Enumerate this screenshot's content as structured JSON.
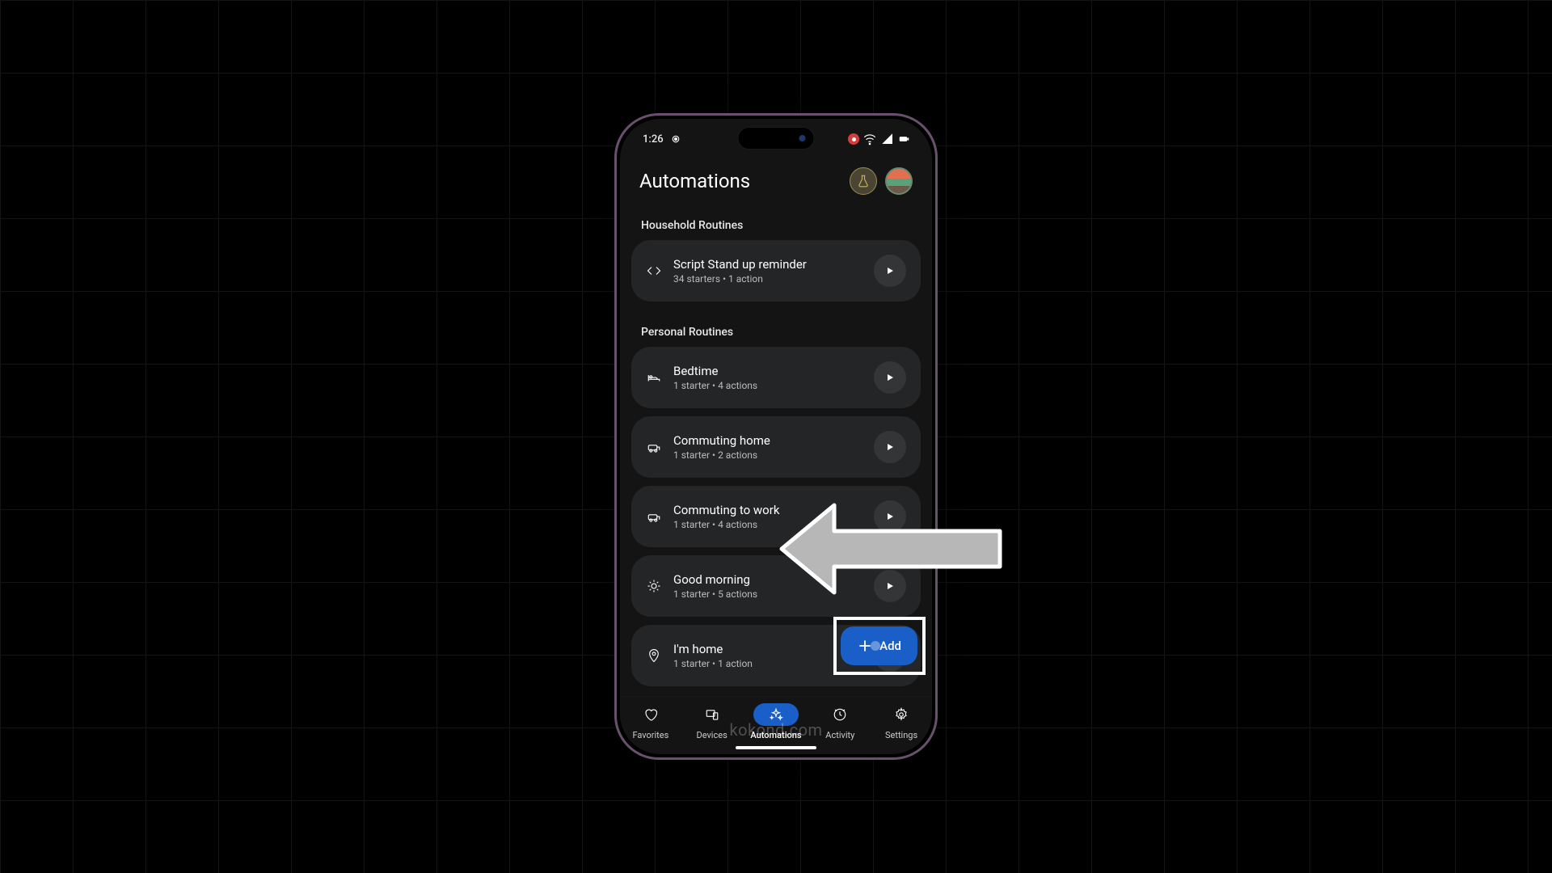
{
  "status": {
    "time": "1:26",
    "rec_icon": "record-icon",
    "wifi": "wifi-icon",
    "signal": "signal-icon",
    "battery": "battery-icon"
  },
  "header": {
    "title": "Automations",
    "lab_icon": "lab-flask-icon",
    "avatar_alt": "profile-avatar"
  },
  "sections": {
    "household": {
      "label": "Household Routines",
      "items": [
        {
          "icon": "code-icon",
          "title": "Script Stand up reminder",
          "subtitle": "34 starters • 1 action"
        }
      ]
    },
    "personal": {
      "label": "Personal Routines",
      "items": [
        {
          "icon": "bed-icon",
          "title": "Bedtime",
          "subtitle": "1 starter • 4 actions"
        },
        {
          "icon": "commute-home-icon",
          "title": "Commuting home",
          "subtitle": "1 starter • 2 actions"
        },
        {
          "icon": "commute-work-icon",
          "title": "Commuting to work",
          "subtitle": "1 starter • 4 actions"
        },
        {
          "icon": "sun-icon",
          "title": "Good morning",
          "subtitle": "1 starter • 5 actions"
        },
        {
          "icon": "location-icon",
          "title": "I'm home",
          "subtitle": "1 starter • 1 action"
        }
      ]
    }
  },
  "fab": {
    "label": "Add"
  },
  "nav": [
    {
      "icon": "heart-icon",
      "label": "Favorites",
      "active": false
    },
    {
      "icon": "devices-icon",
      "label": "Devices",
      "active": false
    },
    {
      "icon": "sparkle-icon",
      "label": "Automations",
      "active": true
    },
    {
      "icon": "activity-icon",
      "label": "Activity",
      "active": false
    },
    {
      "icon": "gear-icon",
      "label": "Settings",
      "active": false
    }
  ],
  "watermark": "kokond.com"
}
